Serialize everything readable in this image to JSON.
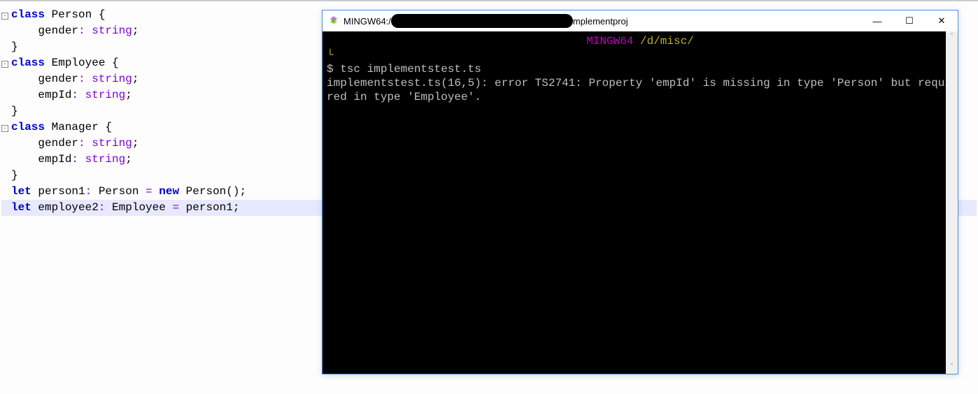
{
  "code": {
    "lines": [
      {
        "tokens": [
          {
            "t": "class ",
            "c": "kw"
          },
          {
            "t": "Person {",
            "c": "cls"
          }
        ],
        "fold": "start"
      },
      {
        "tokens": [
          {
            "t": "    gender",
            "c": "prop"
          },
          {
            "t": ": ",
            "c": "op"
          },
          {
            "t": "string",
            "c": "type"
          },
          {
            "t": ";",
            "c": "punct"
          }
        ]
      },
      {
        "tokens": [
          {
            "t": "}",
            "c": "cls"
          }
        ],
        "fold": "end"
      },
      {
        "tokens": [
          {
            "t": "",
            "c": ""
          }
        ]
      },
      {
        "tokens": [
          {
            "t": "class ",
            "c": "kw"
          },
          {
            "t": "Employee {",
            "c": "cls"
          }
        ],
        "fold": "start"
      },
      {
        "tokens": [
          {
            "t": "    gender",
            "c": "prop"
          },
          {
            "t": ": ",
            "c": "op"
          },
          {
            "t": "string",
            "c": "type"
          },
          {
            "t": ";",
            "c": "punct"
          }
        ]
      },
      {
        "tokens": [
          {
            "t": "    empId",
            "c": "prop"
          },
          {
            "t": ": ",
            "c": "op"
          },
          {
            "t": "string",
            "c": "type"
          },
          {
            "t": ";",
            "c": "punct"
          }
        ]
      },
      {
        "tokens": [
          {
            "t": "}",
            "c": "cls"
          }
        ],
        "fold": "end"
      },
      {
        "tokens": [
          {
            "t": "",
            "c": ""
          }
        ]
      },
      {
        "tokens": [
          {
            "t": "class ",
            "c": "kw"
          },
          {
            "t": "Manager {",
            "c": "cls"
          }
        ],
        "fold": "start"
      },
      {
        "tokens": [
          {
            "t": "    gender",
            "c": "prop"
          },
          {
            "t": ": ",
            "c": "op"
          },
          {
            "t": "string",
            "c": "type"
          },
          {
            "t": ";",
            "c": "punct"
          }
        ]
      },
      {
        "tokens": [
          {
            "t": "    empId",
            "c": "prop"
          },
          {
            "t": ": ",
            "c": "op"
          },
          {
            "t": "string",
            "c": "type"
          },
          {
            "t": ";",
            "c": "punct"
          }
        ]
      },
      {
        "tokens": [
          {
            "t": "}",
            "c": "cls"
          }
        ],
        "fold": "end"
      },
      {
        "tokens": [
          {
            "t": "",
            "c": ""
          }
        ]
      },
      {
        "tokens": [
          {
            "t": "let ",
            "c": "kw"
          },
          {
            "t": "person1",
            "c": "prop"
          },
          {
            "t": ": ",
            "c": "op"
          },
          {
            "t": "Person ",
            "c": "cls"
          },
          {
            "t": "= ",
            "c": "op"
          },
          {
            "t": "new ",
            "c": "kw"
          },
          {
            "t": "Person",
            "c": "cls"
          },
          {
            "t": "();",
            "c": "punct"
          }
        ]
      },
      {
        "tokens": [
          {
            "t": "let ",
            "c": "kw"
          },
          {
            "t": "employee2",
            "c": "prop"
          },
          {
            "t": ": ",
            "c": "op"
          },
          {
            "t": "Employee ",
            "c": "cls"
          },
          {
            "t": "= ",
            "c": "op"
          },
          {
            "t": "person1",
            "c": "prop"
          },
          {
            "t": ";",
            "c": "punct"
          }
        ],
        "highlight": true
      }
    ]
  },
  "terminal": {
    "title_prefix": "MINGW64:/",
    "title_suffix": "mplementproj",
    "header_env": "MINGW64 ",
    "header_path": "/d/misc/",
    "prompt_marker": "$ ",
    "command": "tsc implementstest.ts",
    "output": "implementstest.ts(16,5): error TS2741: Property 'empId' is missing in type 'Person' but required in type 'Employee'."
  },
  "win_controls": {
    "minimize": "—",
    "maximize": "☐",
    "close": "✕"
  },
  "scrollbar": {
    "up": "ˆ",
    "down": "ˇ"
  }
}
